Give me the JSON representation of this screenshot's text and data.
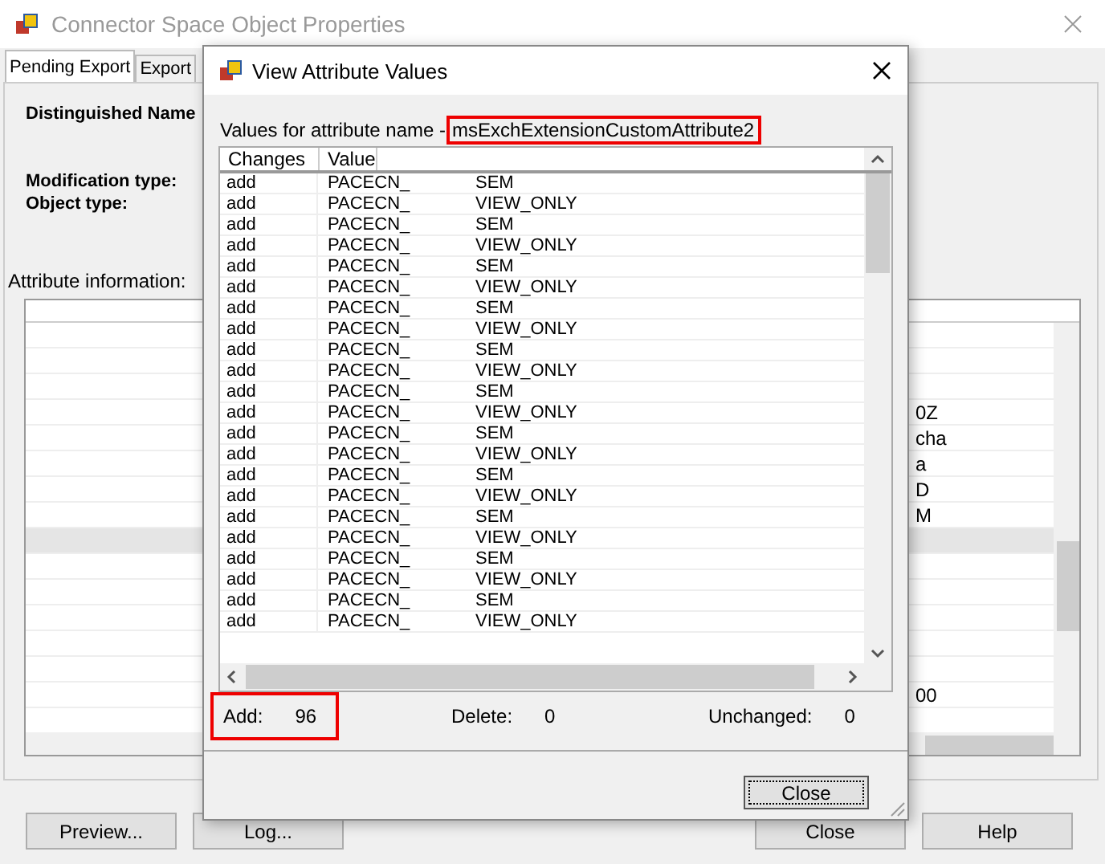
{
  "window": {
    "title": "Connector Space Object Properties"
  },
  "tabs": [
    {
      "label": "Pending Export",
      "selected": true
    },
    {
      "label": "Export",
      "selected": false
    }
  ],
  "fields": {
    "distinguished_name": "Distinguished Name",
    "modification_type": "Modification type:",
    "object_type": "Object type:"
  },
  "attribute_info": {
    "label": "Attribute information:",
    "rows": [
      {
        "selected": false
      },
      {
        "selected": false
      },
      {
        "selected": false
      },
      {
        "fragment": "0Z",
        "selected": false
      },
      {
        "fragment": "cha",
        "selected": false
      },
      {
        "fragment": "a",
        "selected": false
      },
      {
        "fragment": "D",
        "selected": false
      },
      {
        "fragment": "M",
        "selected": false
      },
      {
        "selected": true
      },
      {
        "selected": false
      },
      {
        "selected": false
      },
      {
        "selected": false
      },
      {
        "selected": false
      },
      {
        "selected": false
      },
      {
        "fragment": "00",
        "selected": false
      }
    ]
  },
  "buttons": [
    "Preview...",
    "Log...",
    "Close",
    "Help"
  ],
  "dialog": {
    "title": "View Attribute Values",
    "prompt": "Values for attribute name - ",
    "attribute_name": "msExchExtensionCustomAttribute2",
    "columns": [
      "Changes",
      "Value"
    ],
    "rows": [
      {
        "change": "add",
        "value": "PACECN_",
        "suffix": "SEM"
      },
      {
        "change": "add",
        "value": "PACECN_",
        "suffix": "VIEW_ONLY"
      },
      {
        "change": "add",
        "value": "PACECN_",
        "suffix": "SEM"
      },
      {
        "change": "add",
        "value": "PACECN_",
        "suffix": "VIEW_ONLY"
      },
      {
        "change": "add",
        "value": "PACECN_",
        "suffix": "SEM"
      },
      {
        "change": "add",
        "value": "PACECN_",
        "suffix": "VIEW_ONLY"
      },
      {
        "change": "add",
        "value": "PACECN_",
        "suffix": "SEM"
      },
      {
        "change": "add",
        "value": "PACECN_",
        "suffix": "VIEW_ONLY"
      },
      {
        "change": "add",
        "value": "PACECN_",
        "suffix": "SEM"
      },
      {
        "change": "add",
        "value": "PACECN_",
        "suffix": "VIEW_ONLY"
      },
      {
        "change": "add",
        "value": "PACECN_",
        "suffix": "SEM"
      },
      {
        "change": "add",
        "value": "PACECN_",
        "suffix": "VIEW_ONLY"
      },
      {
        "change": "add",
        "value": "PACECN_",
        "suffix": "SEM"
      },
      {
        "change": "add",
        "value": "PACECN_",
        "suffix": "VIEW_ONLY"
      },
      {
        "change": "add",
        "value": "PACECN_",
        "suffix": "SEM"
      },
      {
        "change": "add",
        "value": "PACECN_",
        "suffix": "VIEW_ONLY"
      },
      {
        "change": "add",
        "value": "PACECN_",
        "suffix": "SEM"
      },
      {
        "change": "add",
        "value": "PACECN_",
        "suffix": "VIEW_ONLY"
      },
      {
        "change": "add",
        "value": "PACECN_",
        "suffix": "SEM"
      },
      {
        "change": "add",
        "value": "PACECN_",
        "suffix": "VIEW_ONLY"
      },
      {
        "change": "add",
        "value": "PACECN_",
        "suffix": "SEM"
      },
      {
        "change": "add",
        "value": "PACECN_",
        "suffix": "VIEW_ONLY"
      }
    ],
    "stats": [
      {
        "label": "Add:",
        "value": "96",
        "highlighted": true
      },
      {
        "label": "Delete:",
        "value": "0",
        "highlighted": false
      },
      {
        "label": "Unchanged:",
        "value": "0",
        "highlighted": false
      }
    ],
    "close_button": "Close"
  }
}
